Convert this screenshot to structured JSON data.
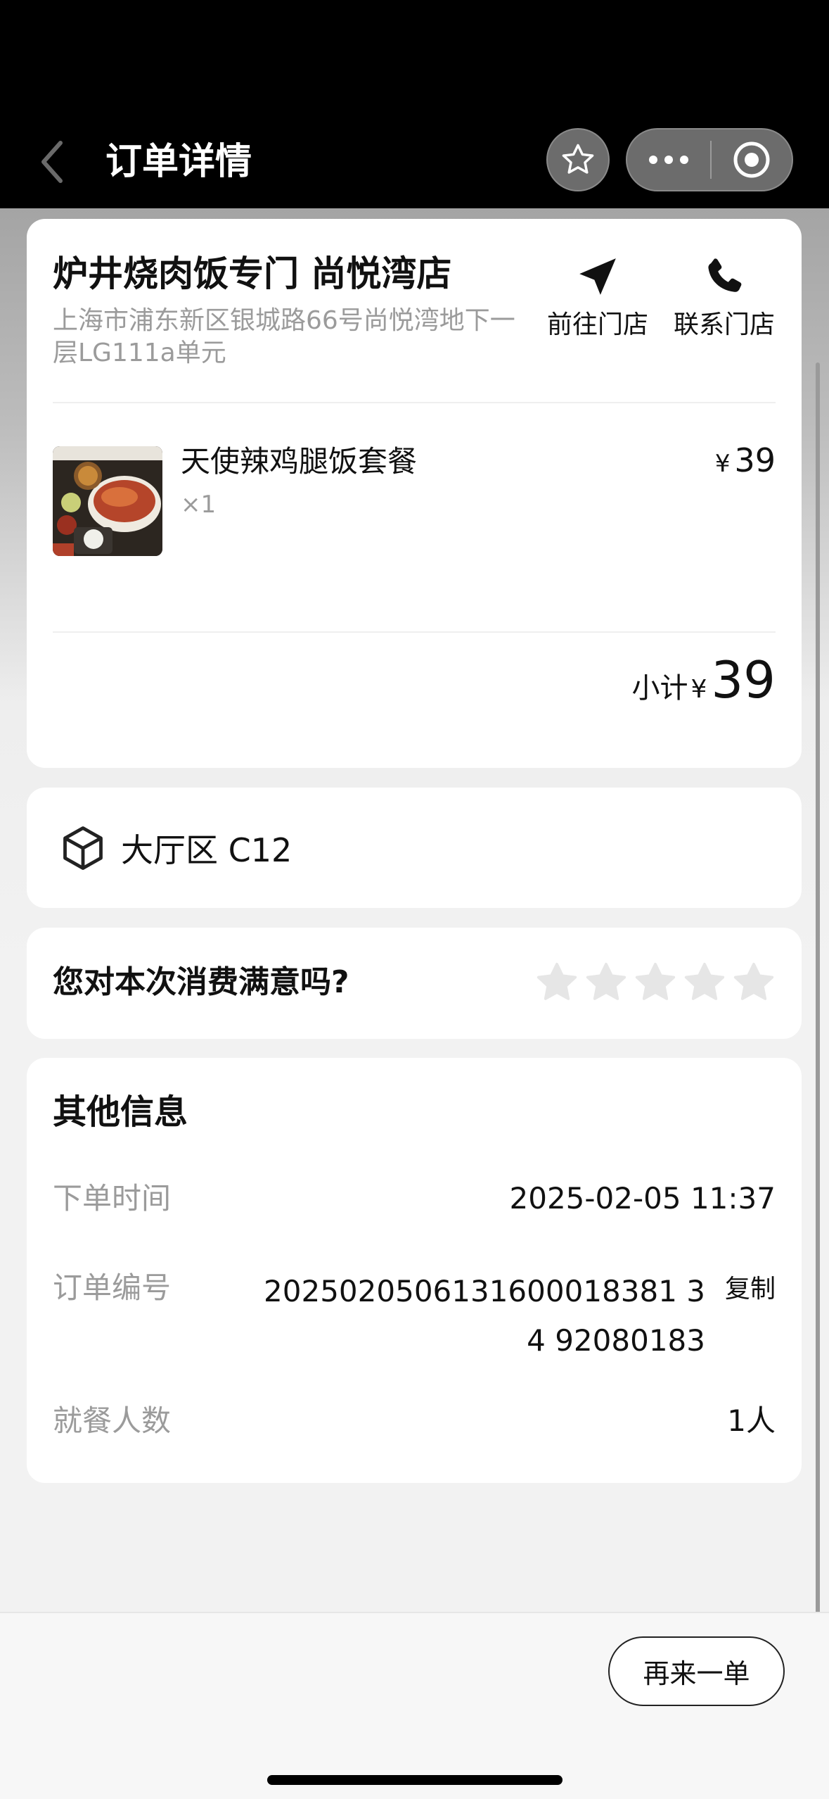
{
  "nav": {
    "title": "订单详情",
    "icons": {
      "back": "chevron-left-icon",
      "favorite": "star-outline-icon",
      "more": "more-dots-icon",
      "close": "target-circle-icon"
    }
  },
  "store": {
    "name": "炉井烧肉饭专门 尚悦湾店",
    "address": "上海市浦东新区银城路66号尚悦湾地下一层LG111a单元",
    "navigate_label": "前往门店",
    "call_label": "联系门店"
  },
  "item": {
    "name": "天使辣鸡腿饭套餐",
    "qty": "×1",
    "currency": "¥",
    "price": "39"
  },
  "subtotal": {
    "label": "小计",
    "currency": "¥",
    "amount": "39"
  },
  "table": {
    "label": "大厅区 C12",
    "icon": "cube-icon"
  },
  "rating": {
    "question": "您对本次消费满意吗?",
    "max_stars": 5,
    "selected": 0,
    "star_color": "#e6e6e6"
  },
  "info": {
    "heading": "其他信息",
    "order_time_label": "下单时间",
    "order_time": "2025-02-05 11:37",
    "order_no_label": "订单编号",
    "order_no": "2025020506131600018381 34 92080183",
    "copy_label": "复制",
    "diners_label": "就餐人数",
    "diners": "1人"
  },
  "footer": {
    "reorder_label": "再来一单"
  }
}
